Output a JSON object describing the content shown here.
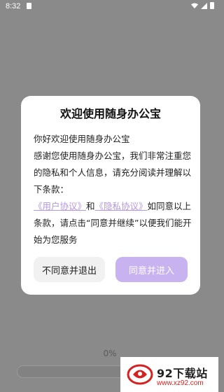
{
  "status_bar": {
    "time": "8:32"
  },
  "dialog": {
    "title": "欢迎使用随身办公宝",
    "greeting": "你好欢迎使用随身办公宝",
    "paragraph_start": "感谢您使用随身办公宝，我们非常注重您的隐私和个人信息，请充分阅读并理解以下条款：",
    "user_agreement_link": "《用户协议》",
    "and_text": "和",
    "privacy_policy_link": "《隐私协议》",
    "paragraph_end": "如同意以上条款，请点击“同意并继续”以便我们能开始为您服务",
    "decline_button": "不同意并退出",
    "accept_button": "同意并进入"
  },
  "progress": {
    "label": "0%",
    "value_percent": 0
  },
  "watermark": {
    "title": "92下载站",
    "url": "www.xz92.com"
  },
  "colors": {
    "accent": "#c8b2ef",
    "link": "#b596e4",
    "overlay": "#8a8a8a"
  }
}
